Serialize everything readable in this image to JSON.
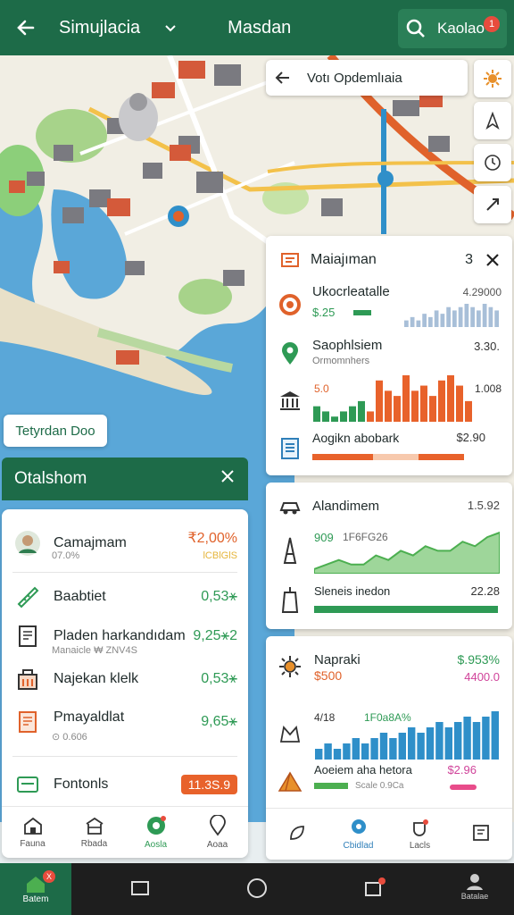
{
  "header": {
    "app_title": "Simujlacia",
    "mode_title": "Masdan",
    "search_label": "Kaolao",
    "search_badge": "1"
  },
  "map": {
    "search_placeholder": "Votı Opdemlıaia",
    "chip_label": "Tetyrdan Doo",
    "tool_icons": [
      "sun-icon",
      "compass-icon",
      "clock-icon",
      "draw-icon"
    ]
  },
  "panel_left": {
    "title": "Otalshom",
    "rows": [
      {
        "name": "Camajmam",
        "sub": "07.0%",
        "value": "₹2,00%",
        "value_sub": "lCBlGlS",
        "value_color": "#e0622b",
        "icon": "avatar-icon"
      },
      {
        "name": "Baabtiet",
        "sub": "",
        "value": "0,53⚹",
        "value_sub": "",
        "value_color": "#2e9a55",
        "icon": "ruler-icon"
      },
      {
        "name": "Pladen harkandıdam",
        "sub": "Manaicle ₩ ZNV4S",
        "value": "9,25⚹2",
        "value_sub": "",
        "value_color": "#2e9a55",
        "icon": "document-icon"
      },
      {
        "name": "Najekan klelk",
        "sub": "",
        "value": "0,53⚹",
        "value_sub": "",
        "value_color": "#2e9a55",
        "icon": "building-icon"
      },
      {
        "name": "Pmayaldlat",
        "sub": "⊙ 0.606",
        "value": "9,65⚹",
        "value_sub": "",
        "value_color": "#2e9a55",
        "icon": "document-icon"
      },
      {
        "name": "Fontonls",
        "sub": "",
        "value": "11.3S.9",
        "value_sub": "",
        "value_color": "#ffffff",
        "icon": "card-icon"
      }
    ],
    "tabs": [
      {
        "label": "Fauna",
        "icon": "house-icon"
      },
      {
        "label": "Rbada",
        "icon": "shop-icon"
      },
      {
        "label": "Aosla",
        "icon": "target-icon"
      },
      {
        "label": "Aoaa",
        "icon": "pin-icon"
      }
    ]
  },
  "panel_right_1": {
    "title": "Maiajıman",
    "count": "3",
    "rows": [
      {
        "name": "Ukocrleatalle",
        "value_main": "$.25",
        "value_right": "4.29000",
        "icon": "donut-icon"
      },
      {
        "name": "Saophlsiem",
        "sub": "Ormomnhers",
        "value_right": "3.30.",
        "icon": "pin-icon"
      },
      {
        "name": "",
        "value_main": "5.0",
        "value_right": "1.008",
        "icon": "temple-icon"
      },
      {
        "name": "Aogikn abobark",
        "value_right": "$2.90",
        "icon": "list-icon"
      }
    ]
  },
  "panel_right_2": {
    "rows": [
      {
        "name": "Alandimem",
        "value_right": "1.5.92",
        "icon": "car-icon"
      },
      {
        "name": "",
        "value_main": "909",
        "sub": "1F6FG26",
        "icon": "tower-icon"
      },
      {
        "name": "Sleneis inedon",
        "value_right": "22.28",
        "icon": "tower-icon"
      }
    ]
  },
  "panel_right_3": {
    "rows": [
      {
        "name": "Napraki",
        "value_main": "$500",
        "value_right": "$.953%",
        "value_right2": "4400.0",
        "icon": "gear-icon"
      },
      {
        "name": "",
        "value_main": "4/18",
        "sub": "1F0a8A%",
        "icon": "gift-icon"
      },
      {
        "name": "Aoeiem aha hetora",
        "sub": "Scale 0.9Ca",
        "value_right": "$2.96",
        "icon": "tent-icon"
      }
    ],
    "tabs": [
      {
        "label": "",
        "icon": "leaf-icon"
      },
      {
        "label": "Cbidlad",
        "icon": "pin-icon"
      },
      {
        "label": "Lacls",
        "icon": "cup-icon"
      },
      {
        "label": "",
        "icon": "note-icon"
      }
    ]
  },
  "sysnav": {
    "home_label": "Batem",
    "profile_label": "Batalae",
    "home_badge": "X",
    "tasks_badge": "•"
  },
  "chart_data": [
    {
      "type": "bar",
      "title": "Ukocrleatalle",
      "values": [
        2,
        3,
        2,
        4,
        3,
        5,
        4,
        6,
        5,
        6,
        7,
        6,
        5,
        7,
        6,
        5
      ],
      "color": "#a8bfd8"
    },
    {
      "type": "bar",
      "title": "Saophlsiem",
      "values": [
        3,
        2,
        1,
        2,
        3,
        4,
        2,
        8,
        6,
        5,
        9,
        6,
        7,
        5,
        8,
        9,
        7,
        4
      ],
      "colors": [
        "#2e9a55",
        "#e8622b"
      ]
    },
    {
      "type": "area",
      "title": "Alandimem",
      "values": [
        1,
        2,
        3,
        2,
        2,
        4,
        3,
        5,
        4,
        6,
        5,
        5,
        7,
        6,
        8,
        9
      ],
      "color": "#4caf50"
    },
    {
      "type": "bar",
      "title": "Napraki",
      "values": [
        2,
        3,
        2,
        3,
        4,
        3,
        4,
        5,
        4,
        5,
        6,
        5,
        6,
        7,
        6,
        7,
        8,
        7,
        8,
        9
      ],
      "color": "#2f8fc9"
    }
  ]
}
